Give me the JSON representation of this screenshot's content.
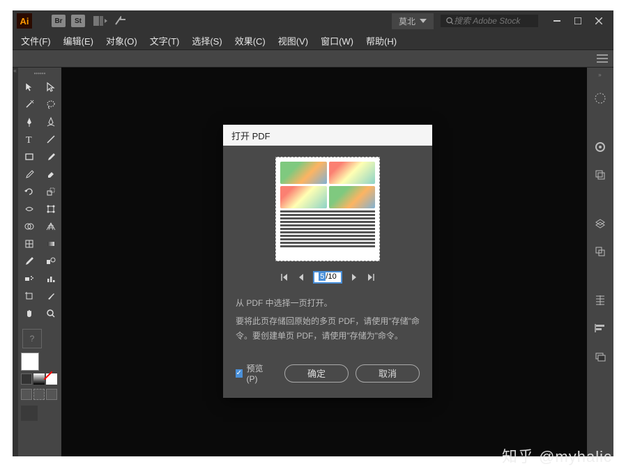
{
  "title_bar": {
    "user_name": "莫北",
    "search_placeholder": "搜索 Adobe Stock"
  },
  "menu": {
    "items": [
      "文件(F)",
      "编辑(E)",
      "对象(O)",
      "文字(T)",
      "选择(S)",
      "效果(C)",
      "视图(V)",
      "窗口(W)",
      "帮助(H)"
    ]
  },
  "dialog": {
    "title": "打开 PDF",
    "page_current": "5",
    "page_total": "/10",
    "instruction": "从 PDF 中选择一页打开。",
    "note": "要将此页存储回原始的多页 PDF，请使用\"存储\"命令。要创建单页 PDF，请使用\"存储为\"命令。",
    "preview_label": "预览 (P)",
    "ok": "确定",
    "cancel": "取消"
  },
  "watermark": "知乎 @myhalic"
}
